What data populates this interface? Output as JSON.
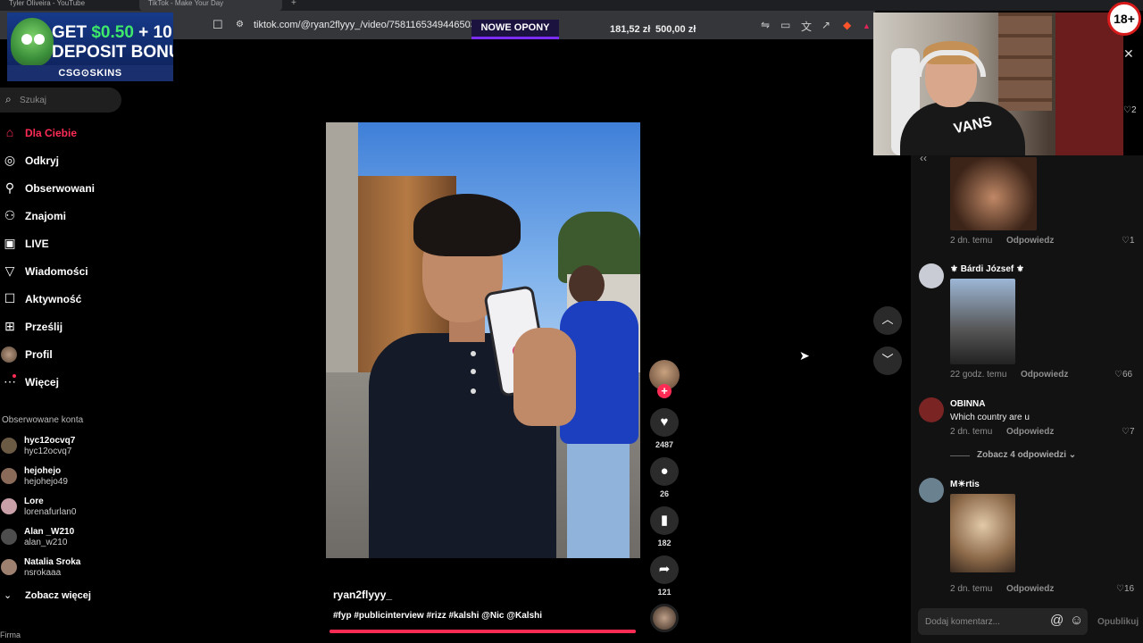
{
  "browser": {
    "tabs": [
      {
        "label": "Tyler Oliveira - YouTube"
      },
      {
        "label": "TikTok - Make Your Day"
      }
    ],
    "url": "tiktok.com/@ryan2flyyy_/video/7581165349446503711",
    "promo_label": "NOWE OPONY",
    "balance1": "181,52 zł",
    "balance2": "500,00 zł"
  },
  "ad": {
    "line1_prefix": "GET ",
    "line1_amount": "$0.50",
    "line1_suffix": " + 10",
    "line2": "DEPOSIT BONU",
    "brand": "CSG⊙SKINS"
  },
  "sidebar": {
    "search_placeholder": "Szukaj",
    "nav": [
      {
        "label": "Dla Ciebie",
        "icon": "home-icon"
      },
      {
        "label": "Odkryj",
        "icon": "compass-icon"
      },
      {
        "label": "Obserwowani",
        "icon": "following-icon"
      },
      {
        "label": "Znajomi",
        "icon": "friends-icon"
      },
      {
        "label": "LIVE",
        "icon": "live-icon"
      },
      {
        "label": "Wiadomości",
        "icon": "messages-icon"
      },
      {
        "label": "Aktywność",
        "icon": "activity-icon"
      },
      {
        "label": "Prześlij",
        "icon": "upload-icon"
      },
      {
        "label": "Profil",
        "icon": "profile-avatar"
      },
      {
        "label": "Więcej",
        "icon": "more-icon"
      }
    ],
    "followed_title": "Obserwowane konta",
    "accounts": [
      {
        "name": "hyc12ocvq7",
        "handle": "hyc12ocvq7"
      },
      {
        "name": "hejohejo",
        "handle": "hejohejo49"
      },
      {
        "name": "Lore",
        "handle": "lorenafurlan0"
      },
      {
        "name": "Alan _W210",
        "handle": "alan_w210"
      },
      {
        "name": "Natalia Sroka",
        "handle": "nsrokaaa"
      }
    ],
    "see_more": "Zobacz więcej",
    "footer": "Firma"
  },
  "video": {
    "author": "ryan2flyyy_",
    "caption": "#fyp #publicinterview #rizz #kalshi @Nic @Kalshi",
    "likes": "2487",
    "comments": "26",
    "saves": "182",
    "shares": "121",
    "progress": 1.0
  },
  "overlay": {
    "age_badge": "18+",
    "top_like_count": "2"
  },
  "comments": [
    {
      "meta": "2 dn. temu",
      "reply": "Odpowiedz",
      "likes": "1"
    },
    {
      "name": "⚜ Bárdi József ⚜",
      "meta": "22 godz. temu",
      "reply": "Odpowiedz",
      "likes": "66"
    },
    {
      "name": "OBINNA",
      "text": "Which country are u",
      "meta": "2 dn. temu",
      "reply": "Odpowiedz",
      "likes": "7",
      "view_replies": "Zobacz 4 odpowiedzi"
    },
    {
      "name": "M☀rtis",
      "meta": "2 dn. temu",
      "reply": "Odpowiedz",
      "likes": "16"
    }
  ],
  "composer": {
    "placeholder": "Dodaj komentarz...",
    "publish": "Opublikuj"
  },
  "colors": {
    "accent": "#fe2c55",
    "promo_border": "#7b2cff",
    "background": "#000000",
    "panel": "#121212"
  }
}
